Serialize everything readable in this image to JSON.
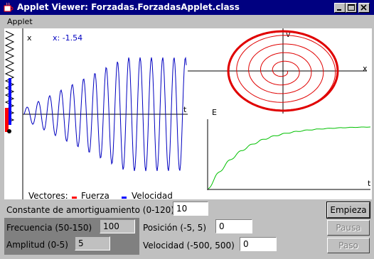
{
  "window": {
    "title": "Applet Viewer: Forzadas.ForzadasApplet.class"
  },
  "menu": {
    "items": [
      "Applet"
    ]
  },
  "plot": {
    "x_label": "x",
    "x_readout": "x: -1.54",
    "t_label": "t",
    "v_label": "v",
    "phase_x_label": "x",
    "energy_label": "E",
    "energy_t_label": "t",
    "legend_title": "Vectores:",
    "legend_force": "Fuerza",
    "legend_velocity": "Velocidad",
    "colors": {
      "wave": "#0000c0",
      "phase": "#e00000",
      "energy": "#00c000",
      "force": "#ff0000",
      "velocity": "#0000ff"
    }
  },
  "controls": {
    "damping_label": "Constante de amortiguamiento (0-120)",
    "damping_value": "10",
    "frequency_label": "Frecuencia (50-150)",
    "frequency_value": "100",
    "amplitude_label": "Amplitud (0-5)",
    "amplitude_value": "5",
    "position_label": "Posición (-5, 5)",
    "position_value": "0",
    "velocity_label": "Velocidad (-500, 500)",
    "velocity_value": "0"
  },
  "buttons": {
    "start": "Empieza",
    "pause": "Pausa",
    "step": "Paso"
  }
}
